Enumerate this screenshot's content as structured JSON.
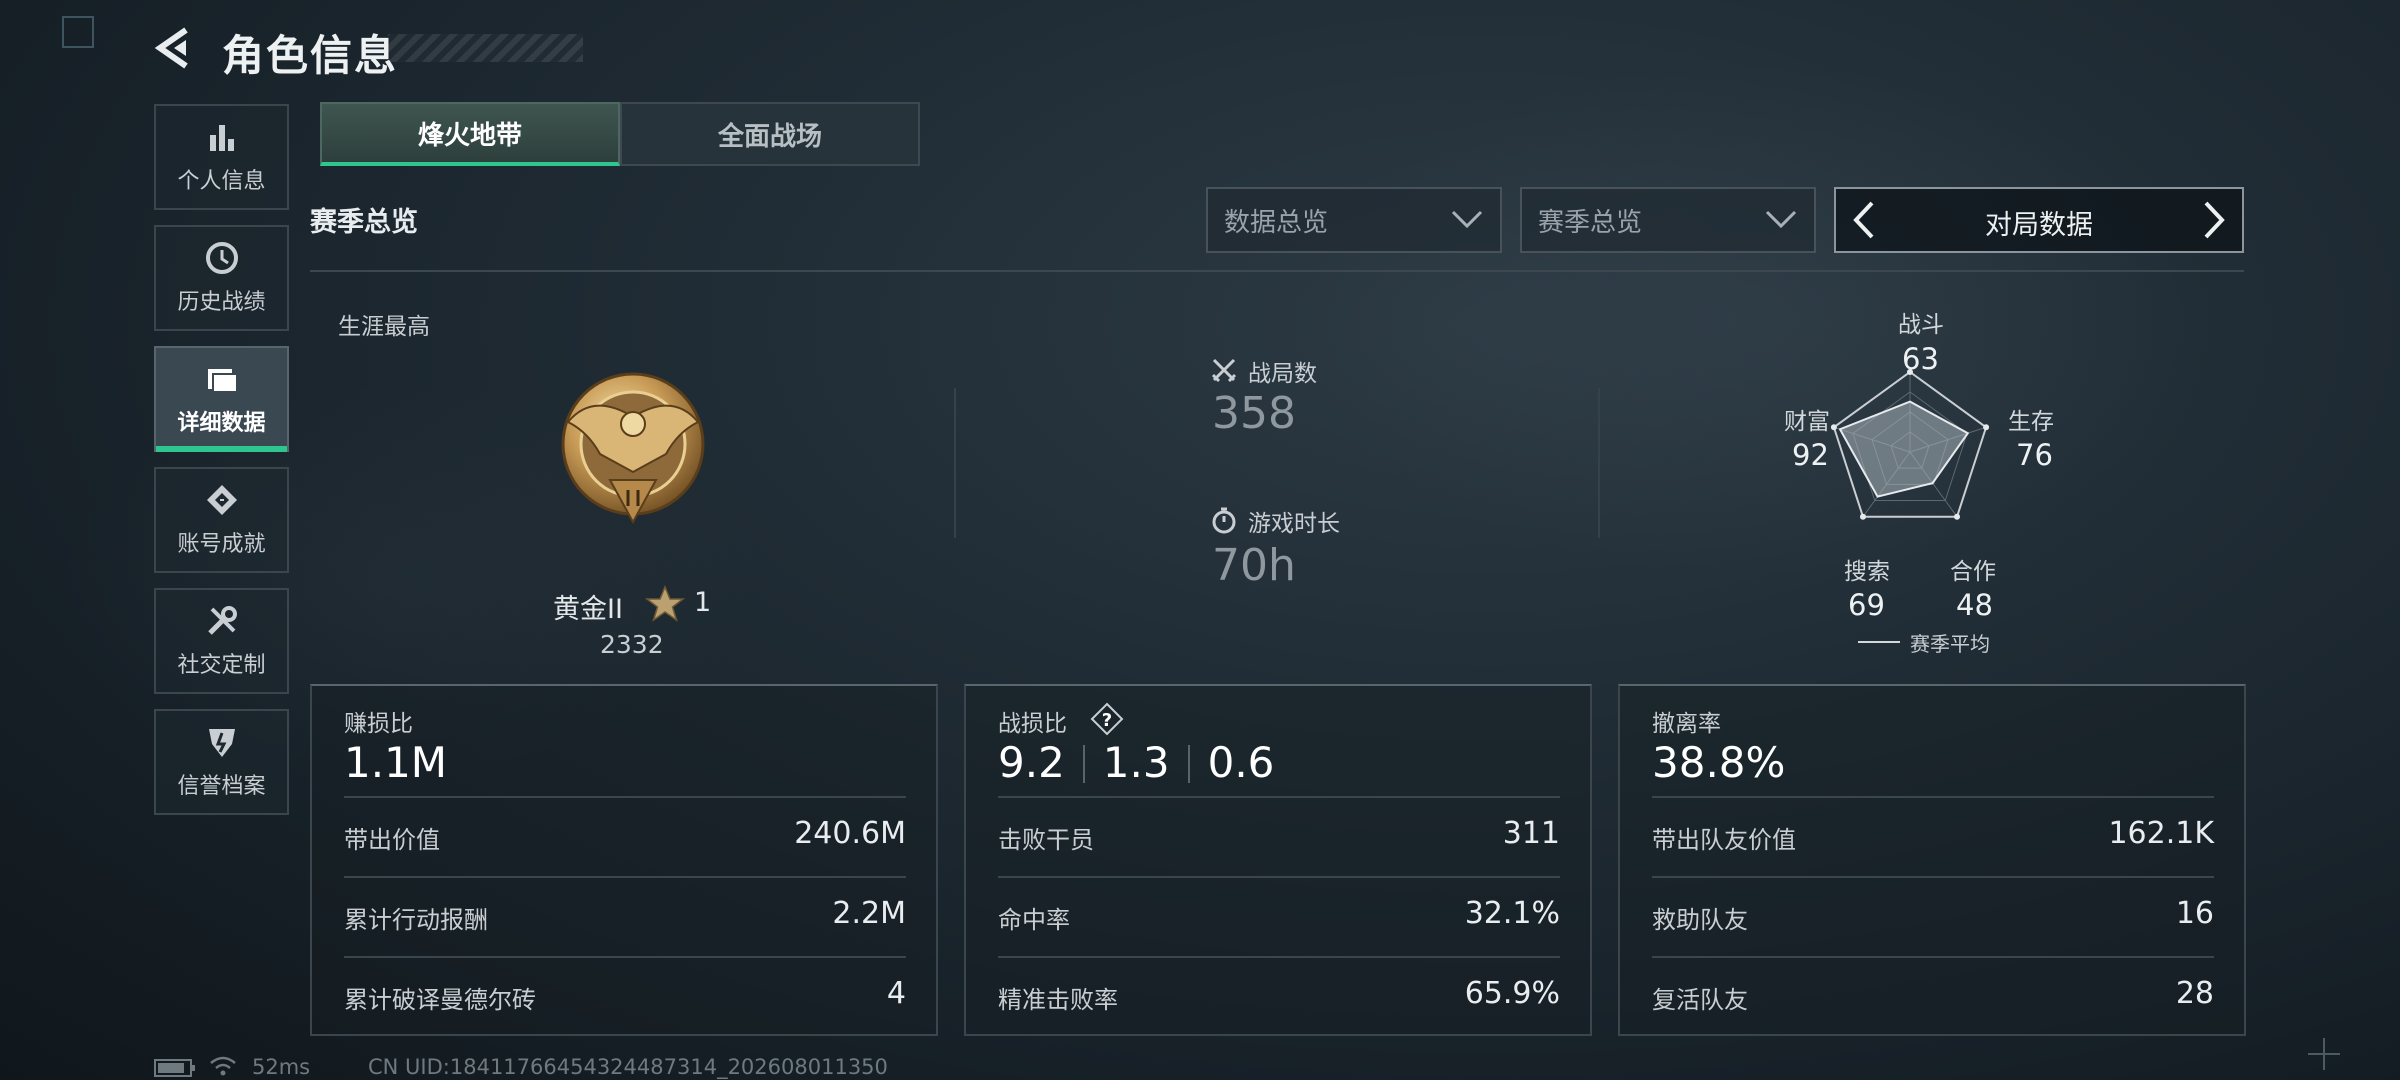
{
  "header": {
    "title": "角色信息"
  },
  "sidebar": {
    "items": [
      {
        "label": "个人信息",
        "icon": "bar-chart-icon"
      },
      {
        "label": "历史战绩",
        "icon": "clock-icon"
      },
      {
        "label": "详细数据",
        "icon": "folder-icon",
        "active": true
      },
      {
        "label": "账号成就",
        "icon": "achievement-icon"
      },
      {
        "label": "社交定制",
        "icon": "tools-icon"
      },
      {
        "label": "信誉档案",
        "icon": "shield-icon"
      }
    ]
  },
  "mode_tabs": [
    {
      "label": "烽火地带",
      "active": true
    },
    {
      "label": "全面战场",
      "active": false
    }
  ],
  "section": {
    "title": "赛季总览",
    "dropdown_1": "数据总览",
    "dropdown_2": "赛季总览",
    "switcher": "对局数据"
  },
  "career": {
    "label": "生涯最高",
    "rank_name": "黄金II",
    "stars": "1",
    "score": "2332"
  },
  "summary": {
    "matches_label": "战局数",
    "matches_value": "358",
    "playtime_label": "游戏时长",
    "playtime_value": "70h"
  },
  "radar": {
    "axes": [
      {
        "label": "战斗",
        "value": "63"
      },
      {
        "label": "生存",
        "value": "76"
      },
      {
        "label": "合作",
        "value": "48"
      },
      {
        "label": "搜索",
        "value": "69"
      },
      {
        "label": "财富",
        "value": "92"
      }
    ],
    "legend": "赛季平均",
    "max": 100
  },
  "panels": {
    "profit": {
      "label": "赚损比",
      "value": "1.1M",
      "rows": [
        {
          "key": "带出价值",
          "value": "240.6M"
        },
        {
          "key": "累计行动报酬",
          "value": "2.2M"
        },
        {
          "key": "累计破译曼德尔砖",
          "value": "4"
        }
      ]
    },
    "kd": {
      "label": "战损比",
      "values": [
        "9.2",
        "1.3",
        "0.6"
      ],
      "rows": [
        {
          "key": "击败干员",
          "value": "311"
        },
        {
          "key": "命中率",
          "value": "32.1%"
        },
        {
          "key": "精准击败率",
          "value": "65.9%"
        }
      ]
    },
    "extract": {
      "label": "撤离率",
      "value": "38.8%",
      "rows": [
        {
          "key": "带出队友价值",
          "value": "162.1K"
        },
        {
          "key": "救助队友",
          "value": "16"
        },
        {
          "key": "复活队友",
          "value": "28"
        }
      ]
    }
  },
  "status_bar": {
    "ping": "52ms",
    "uid": "CN UID:18411766454324487314_202608011350"
  },
  "colors": {
    "accent": "#2fc58e",
    "background": "#1b252d"
  }
}
